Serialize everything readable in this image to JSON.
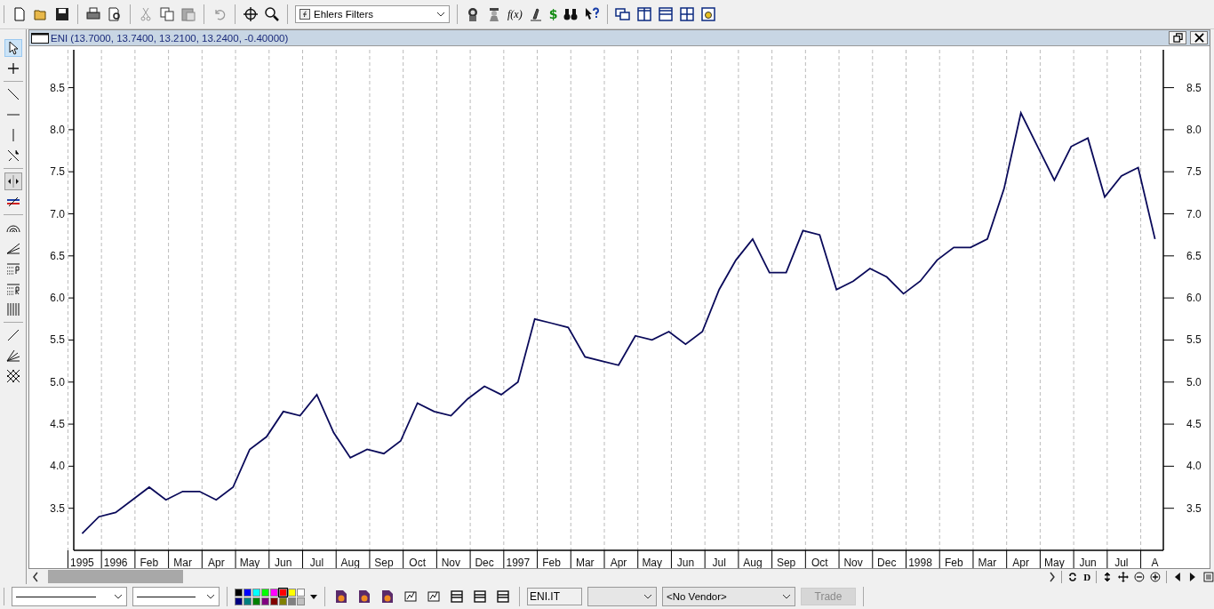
{
  "toolbar": {
    "indicator_dropdown": {
      "value": "Ehlers Filters"
    },
    "function_label": "f(x)",
    "dollar_label": "$"
  },
  "chart_window": {
    "title": "ENI (13.7000, 13.7400, 13.2100, 13.2400, -0.40000)",
    "chart_data": {
      "type": "line",
      "ylim": [
        3.0,
        8.95
      ],
      "categories": [
        "1995",
        null,
        "1996",
        null,
        "Feb",
        null,
        "Mar",
        null,
        "Apr",
        null,
        "May",
        null,
        "Jun",
        null,
        "Jul",
        null,
        "Aug",
        null,
        "Sep",
        null,
        "Oct",
        null,
        "Nov",
        null,
        "Dec",
        null,
        "1997",
        null,
        "Feb",
        null,
        "Mar",
        null,
        "Apr",
        null,
        "May",
        null,
        "Jun",
        null,
        "Jul",
        null,
        "Aug",
        null,
        "Sep",
        null,
        "Oct",
        null,
        "Nov",
        null,
        "Dec",
        null,
        "1998",
        null,
        "Feb",
        null,
        "Mar",
        null,
        "Apr",
        null,
        "May",
        null,
        "Jun",
        null,
        "Jul",
        null,
        "A"
      ],
      "yticks": [
        {
          "value": 3.5,
          "label": "3.5"
        },
        {
          "value": 4,
          "label": "4.0"
        },
        {
          "value": 4.5,
          "label": "4.5"
        },
        {
          "value": 5,
          "label": "5.0"
        },
        {
          "value": 5.5,
          "label": "5.5"
        },
        {
          "value": 6,
          "label": "6.0"
        },
        {
          "value": 6.5,
          "label": "6.5"
        },
        {
          "value": 7,
          "label": "7.0"
        },
        {
          "value": 7.5,
          "label": "7.5"
        },
        {
          "value": 8,
          "label": "8.0"
        },
        {
          "value": 8.5,
          "label": "8.5"
        }
      ],
      "series": [
        {
          "color": "#0a0a5a",
          "values": [
            3.2,
            3.4,
            3.45,
            3.6,
            3.75,
            3.6,
            3.7,
            3.7,
            3.6,
            3.75,
            4.2,
            4.35,
            4.65,
            4.6,
            4.85,
            4.4,
            4.1,
            4.2,
            4.15,
            4.3,
            4.75,
            4.65,
            4.6,
            4.8,
            4.95,
            4.85,
            5.0,
            5.75,
            5.7,
            5.65,
            5.3,
            5.25,
            5.2,
            5.55,
            5.5,
            5.6,
            5.45,
            5.6,
            6.1,
            6.45,
            6.7,
            6.3,
            6.3,
            6.8,
            6.75,
            6.1,
            6.2,
            6.35,
            6.25,
            6.05,
            6.2,
            6.45,
            6.6,
            6.6,
            6.7,
            7.3,
            8.2,
            7.8,
            7.4,
            7.8,
            7.9,
            7.2,
            7.45,
            7.55,
            6.7
          ]
        }
      ]
    }
  },
  "palette": [
    {
      "color": "#000000",
      "selected": false
    },
    {
      "color": "#0000ff",
      "selected": false
    },
    {
      "color": "#00ffff",
      "selected": false
    },
    {
      "color": "#00ff00",
      "selected": false
    },
    {
      "color": "#ff00ff",
      "selected": false
    },
    {
      "color": "#ff0000",
      "selected": true
    },
    {
      "color": "#ffff00",
      "selected": false
    },
    {
      "color": "#ffffff",
      "selected": false
    },
    {
      "color": "#000080",
      "selected": false
    },
    {
      "color": "#008080",
      "selected": false
    },
    {
      "color": "#008000",
      "selected": false
    },
    {
      "color": "#800080",
      "selected": false
    },
    {
      "color": "#800000",
      "selected": false
    },
    {
      "color": "#808000",
      "selected": false
    },
    {
      "color": "#808080",
      "selected": false
    },
    {
      "color": "#c0c0c0",
      "selected": false
    }
  ],
  "scroll_nav": {
    "d_button": "D"
  },
  "bottom_bar": {
    "symbol_field": {
      "value": "ENI.IT"
    },
    "vendor_dropdown": {
      "value": "<No Vendor>"
    },
    "trade_button": {
      "label": "Trade",
      "disabled": true
    }
  }
}
